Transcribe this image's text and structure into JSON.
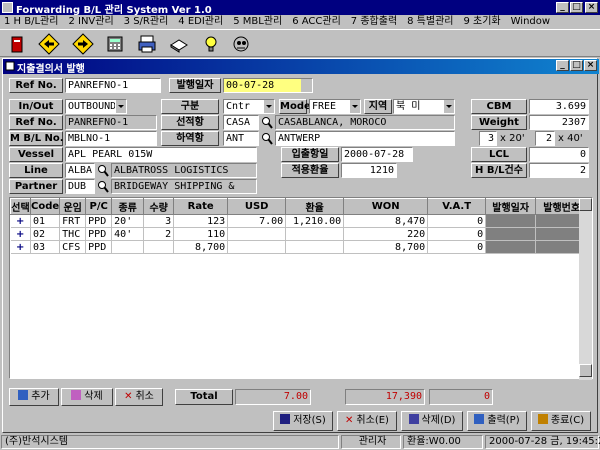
{
  "window": {
    "title": "Forwarding B/L 관리 System Ver 1.0"
  },
  "menu": [
    "1 H B/L관리",
    "2 INV관리",
    "3 S/R관리",
    "4 EDI관리",
    "5 MBL관리",
    "6 ACC관리",
    "7 종합출력",
    "8 특별관리",
    "9 초기화",
    "Window"
  ],
  "toolbar_icons": [
    "exit-icon",
    "back-arrow-icon",
    "forward-arrow-icon",
    "calculator-icon",
    "printer-icon",
    "book-icon",
    "help-bulb-icon",
    "robot-icon"
  ],
  "form": {
    "title": "지출결의서 발행",
    "ref_no_label": "Ref No.",
    "ref_no_value": "PANREFNO-1",
    "issue_date_label": "발행일자",
    "issue_date_value": "00-07-28",
    "inout_label": "In/Out",
    "inout_value": "OUTBOUND",
    "ref_no2_label": "Ref No.",
    "ref_no2_value": "PANREFNO-1",
    "mbl_label": "M B/L No.",
    "mbl_value": "MBLNO-1",
    "vessel_label": "Vessel",
    "vessel_value": "APL PEARL 015W",
    "line_label": "Line",
    "line_code": "ALBA",
    "line_name": "ALBATROSS LOGISTICS",
    "partner_label": "Partner",
    "partner_code": "DUB",
    "partner_name": "BRIDGEWAY SHIPPING &",
    "gubun_label": "구분",
    "gubun_value": "Cntr",
    "mode_label": "Mode",
    "mode_value": "FREE",
    "region_label": "지역",
    "region_value": "북   미",
    "pol_label": "선적항",
    "pol_code": "CASA",
    "pol_name": "CASABLANCA, MOROCO",
    "pod_label": "하역항",
    "pod_code": "ANT",
    "pod_name": "ANTWERP",
    "departure_label": "입출항일",
    "departure_value": "2000-07-28",
    "rate_label": "적용환율",
    "rate_value": "1210",
    "cbm_label": "CBM",
    "cbm_value": "3.699",
    "weight_label": "Weight",
    "weight_value": "2307",
    "cntr20_qty": "3",
    "cntr20_unit": "x 20'",
    "cntr40_qty": "2",
    "cntr40_unit": "x 40'",
    "lcl_label": "LCL",
    "lcl_value": "0",
    "hbl_count_label": "H B/L건수",
    "hbl_count_value": "2"
  },
  "grid": {
    "columns": [
      "선택",
      "Code",
      "운임",
      "P/C",
      "종류",
      "수량",
      "Rate",
      "USD",
      "환율",
      "WON",
      "V.A.T",
      "발행일자",
      "발행번호"
    ],
    "rows": [
      [
        "+",
        "01",
        "FRT",
        "PPD",
        "20'",
        "3",
        "123",
        "7.00",
        "1,210.00",
        "8,470",
        "0",
        "",
        ""
      ],
      [
        "+",
        "02",
        "THC",
        "PPD",
        "40'",
        "2",
        "110",
        "",
        "",
        "220",
        "0",
        "",
        ""
      ],
      [
        "+",
        "03",
        "CFS",
        "PPD",
        "",
        "",
        "8,700",
        "",
        "",
        "8,700",
        "0",
        "",
        ""
      ]
    ]
  },
  "actions": {
    "add": "추가",
    "delete": "삭제",
    "cancel": "취소",
    "total_label": "Total",
    "total_usd": "7.00",
    "total_won": "17,390",
    "total_vat": "0"
  },
  "bottom_buttons": {
    "save": "저장(S)",
    "cancel": "취소(E)",
    "delete": "삭제(D)",
    "print": "출력(P)",
    "exit": "종료(C)"
  },
  "status": {
    "company": "(주)반석시스템",
    "user": "관리자",
    "rate": "환율:W0.00",
    "datetime": "2000-07-28 금, 19:45:20"
  },
  "colors": {
    "title_bar": "#000080",
    "dark_cell": "#808080",
    "total_red": "#c00000",
    "date_yellow": "#ffff80"
  }
}
